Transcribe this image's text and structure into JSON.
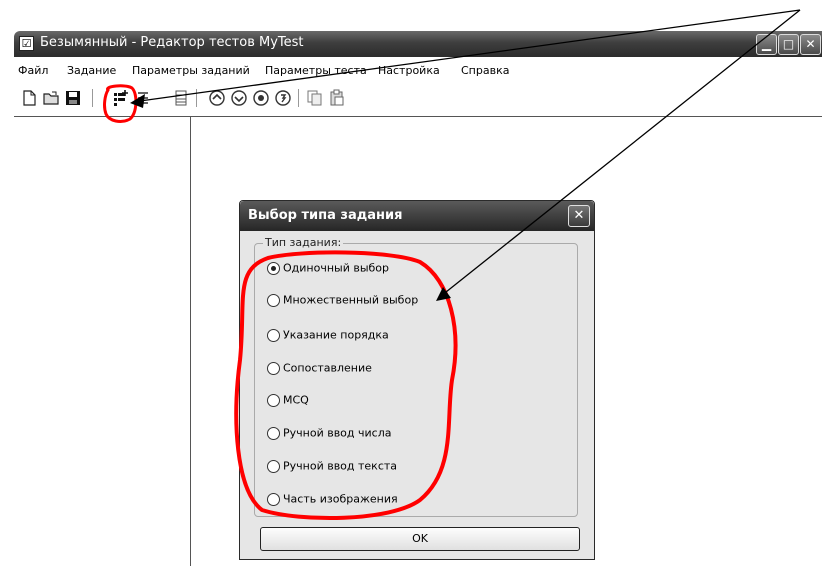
{
  "window": {
    "title": "Безымянный - Редактор тестов MyTest",
    "check_glyph": "☑",
    "min_glyph": "▁",
    "max_glyph": "□",
    "close_glyph": "✕"
  },
  "menu": {
    "items": [
      "Файл",
      "Задание",
      "Параметры заданий",
      "Параметры теста",
      "Настройка",
      "Справка"
    ]
  },
  "toolbar": {
    "icons": [
      "new-file-icon",
      "open-folder-icon",
      "save-icon",
      "add-task-icon",
      "task-list-icon",
      "task-grid-icon",
      "nav-first-icon",
      "nav-prev-icon",
      "nav-next-icon",
      "nav-last-icon",
      "copy-icon",
      "paste-icon"
    ]
  },
  "dialog": {
    "title": "Выбор типа задания",
    "close_glyph": "✕",
    "group_label": "Тип задания:",
    "options": [
      {
        "label": "Одиночный выбор",
        "checked": true
      },
      {
        "label": "Множественный выбор",
        "checked": false
      },
      {
        "label": "Указание порядка",
        "checked": false
      },
      {
        "label": "Сопоставление",
        "checked": false
      },
      {
        "label": "MCQ",
        "checked": false
      },
      {
        "label": "Ручной ввод числа",
        "checked": false
      },
      {
        "label": "Ручной ввод текста",
        "checked": false
      },
      {
        "label": "Часть изображения",
        "checked": false
      }
    ],
    "ok_label": "OK"
  },
  "colors": {
    "annotation": "#ff0000",
    "titlebar": "#3e3e3e"
  }
}
